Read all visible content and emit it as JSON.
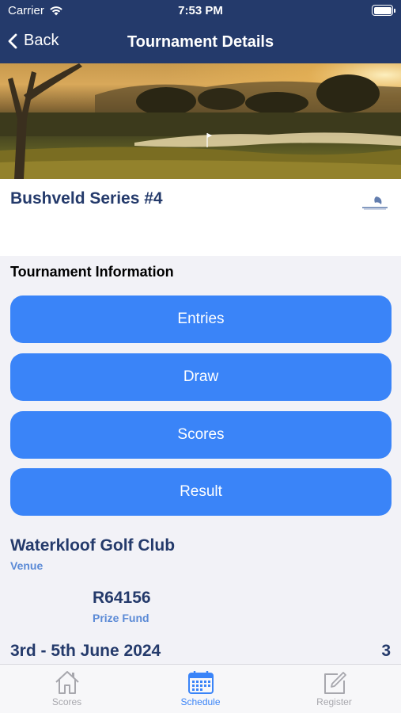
{
  "status_bar": {
    "carrier": "Carrier",
    "time": "7:53 PM"
  },
  "nav": {
    "back_label": "Back",
    "title": "Tournament Details"
  },
  "tournament": {
    "name": "Bushveld Series #4"
  },
  "info": {
    "section_title": "Tournament Information",
    "buttons": [
      {
        "label": "Entries"
      },
      {
        "label": "Draw"
      },
      {
        "label": "Scores"
      },
      {
        "label": "Result"
      }
    ]
  },
  "venue": {
    "name": "Waterkloof Golf Club",
    "label": "Venue"
  },
  "prize": {
    "amount": "R64156",
    "label": "Prize Fund"
  },
  "dates": {
    "range": "3rd - 5th June 2024",
    "count": "3"
  },
  "tabs": [
    {
      "label": "Scores",
      "icon": "home-icon",
      "active": false
    },
    {
      "label": "Schedule",
      "icon": "calendar-icon",
      "active": true
    },
    {
      "label": "Register",
      "icon": "edit-icon",
      "active": false
    }
  ],
  "colors": {
    "nav_bg": "#243a6b",
    "button": "#3a84f8",
    "title": "#243a6b",
    "label": "#5b8ad6"
  }
}
